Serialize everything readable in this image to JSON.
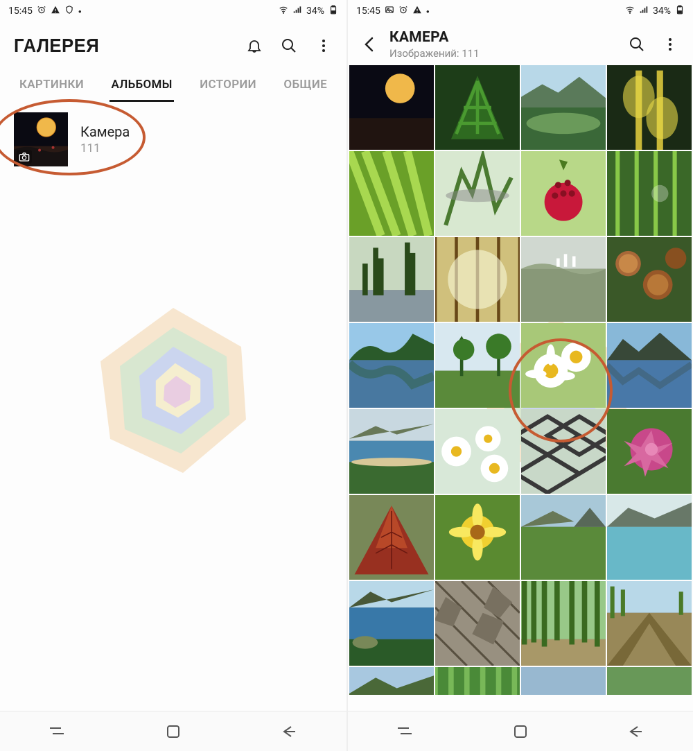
{
  "status": {
    "time": "15:45",
    "battery_text": "34%"
  },
  "left": {
    "title": "ГАЛЕРЕЯ",
    "tabs": [
      "КАРТИНКИ",
      "АЛЬБОМЫ",
      "ИСТОРИИ",
      "ОБЩИЕ"
    ],
    "active_tab_index": 1,
    "album": {
      "name": "Камера",
      "count": "111"
    }
  },
  "right": {
    "title": "КАМЕРА",
    "subtitle": "Изображений: 111"
  }
}
